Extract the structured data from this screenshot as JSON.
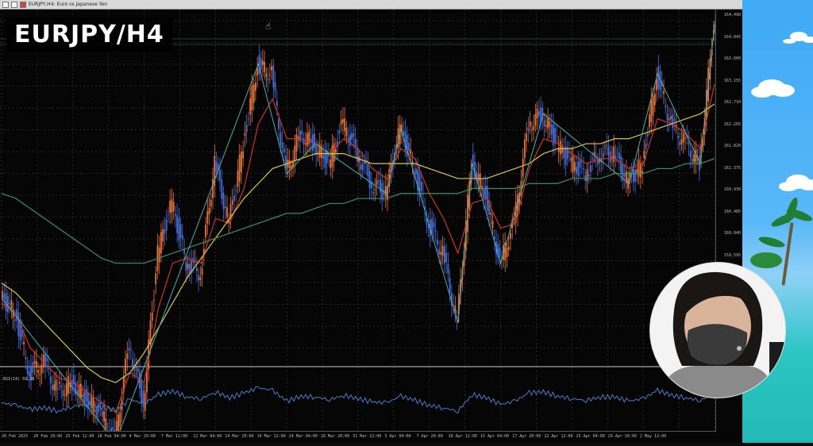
{
  "window": {
    "tab_label": "EURJPY,H4: Euro vs Japanese Yen"
  },
  "overlay": {
    "title": "EURJPY/H4"
  },
  "indicator": {
    "rsi_label": "RSI(14) 59.28"
  },
  "price_axis": {
    "ticks": [
      "164.490",
      "164.045",
      "163.600",
      "163.155",
      "162.710",
      "162.265",
      "161.820",
      "161.375",
      "160.930",
      "160.485",
      "160.040",
      "159.595",
      "159.150",
      "158.705",
      "158.260",
      "157.815"
    ]
  },
  "date_axis": {
    "ticks": [
      "20 Feb 2025",
      "20 Feb 20:00",
      "25 Feb 12:00",
      "28 Feb 04:00",
      "4 Mar 20:00",
      "7 Mar 12:00",
      "12 Mar 04:00",
      "14 Mar 20:00",
      "19 Mar 12:00",
      "24 Mar 04:00",
      "26 Mar 20:00",
      "31 Mar 12:00",
      "3 Apr 04:00",
      "7 Apr 20:00",
      "10 Apr 12:00",
      "15 Apr 04:00",
      "17 Apr 20:00",
      "22 Apr 12:00",
      "25 Apr 04:00",
      "29 Apr 20:00",
      "2 May 12:00"
    ]
  },
  "colors": {
    "bull": "#e8743b",
    "bear": "#4a6fd8",
    "ma_fast": "#c9352b",
    "ma_mid": "#d7c948",
    "ma_slow": "#3c8f6a",
    "zigzag": "#4ab0a8",
    "rsi": "#4a7cc8"
  },
  "icons": {
    "cursor": "hand-cursor-icon"
  },
  "chart_data": {
    "type": "line",
    "title": "EURJPY/H4",
    "x": [
      0,
      1,
      2,
      3,
      4,
      5,
      6,
      7,
      8,
      9,
      10,
      11,
      12,
      13,
      14,
      15,
      16,
      17,
      18,
      19,
      20,
      21,
      22,
      23,
      24,
      25,
      26,
      27,
      28,
      29,
      30,
      31,
      32,
      33,
      34,
      35,
      36,
      37,
      38,
      39,
      40,
      41,
      42,
      43,
      44,
      45,
      46,
      47,
      48,
      49,
      50
    ],
    "series": [
      {
        "values": [
          158.9,
          158.6,
          157.4,
          157.6,
          157.0,
          157.2,
          156.9,
          156.6,
          156.0,
          158.0,
          156.8,
          159.8,
          160.8,
          159.6,
          159.4,
          161.6,
          160.4,
          162.0,
          163.6,
          163.4,
          161.4,
          162.2,
          162.0,
          161.6,
          162.4,
          161.8,
          161.2,
          161.0,
          162.3,
          161.5,
          160.4,
          159.8,
          158.4,
          161.6,
          161.0,
          159.6,
          160.4,
          162.4,
          162.6,
          162.0,
          161.6,
          161.4,
          161.8,
          161.8,
          161.2,
          161.6,
          163.4,
          162.4,
          162.0,
          161.6,
          164.4
        ]
      },
      {
        "values": [
          158.8,
          158.6,
          157.9,
          157.6,
          157.3,
          157.2,
          157.0,
          156.8,
          156.6,
          157.4,
          157.2,
          158.7,
          159.6,
          159.7,
          159.6,
          160.5,
          160.4,
          161.1,
          162.4,
          162.9,
          162.1,
          162.1,
          162.0,
          161.8,
          162.1,
          161.9,
          161.5,
          161.3,
          161.9,
          161.7,
          161.0,
          160.5,
          159.8,
          160.8,
          160.9,
          160.3,
          160.4,
          161.5,
          162.1,
          162.0,
          161.8,
          161.6,
          161.7,
          161.7,
          161.5,
          161.6,
          162.5,
          162.4,
          162.2,
          161.9,
          163.2
        ]
      },
      {
        "values": [
          159.2,
          159.0,
          158.7,
          158.4,
          158.1,
          157.8,
          157.5,
          157.3,
          157.2,
          157.4,
          157.8,
          158.3,
          158.8,
          159.3,
          159.7,
          160.1,
          160.5,
          160.9,
          161.2,
          161.5,
          161.6,
          161.7,
          161.8,
          161.8,
          161.8,
          161.7,
          161.6,
          161.6,
          161.6,
          161.6,
          161.5,
          161.4,
          161.3,
          161.3,
          161.3,
          161.4,
          161.5,
          161.6,
          161.8,
          161.9,
          161.9,
          162.0,
          162.0,
          162.1,
          162.1,
          162.2,
          162.3,
          162.4,
          162.5,
          162.6,
          162.8
        ]
      },
      {
        "values": [
          161.0,
          160.9,
          160.7,
          160.5,
          160.3,
          160.1,
          159.9,
          159.7,
          159.6,
          159.6,
          159.6,
          159.7,
          159.8,
          159.9,
          160.0,
          160.1,
          160.2,
          160.3,
          160.4,
          160.5,
          160.6,
          160.6,
          160.7,
          160.8,
          160.8,
          160.9,
          160.9,
          160.9,
          161.0,
          161.0,
          161.0,
          161.0,
          161.0,
          161.1,
          161.1,
          161.1,
          161.1,
          161.2,
          161.2,
          161.2,
          161.3,
          161.3,
          161.3,
          161.4,
          161.4,
          161.4,
          161.5,
          161.5,
          161.6,
          161.6,
          161.7
        ]
      }
    ],
    "ylim": [
      157.6,
      164.6
    ],
    "rsi": [
      48,
      45,
      40,
      42,
      38,
      44,
      46,
      43,
      39,
      52,
      47,
      58,
      62,
      55,
      53,
      61,
      54,
      60,
      66,
      63,
      50,
      56,
      55,
      52,
      57,
      53,
      49,
      48,
      56,
      51,
      45,
      42,
      38,
      58,
      54,
      46,
      50,
      60,
      61,
      56,
      53,
      51,
      55,
      55,
      50,
      53,
      63,
      57,
      54,
      51,
      59
    ]
  }
}
